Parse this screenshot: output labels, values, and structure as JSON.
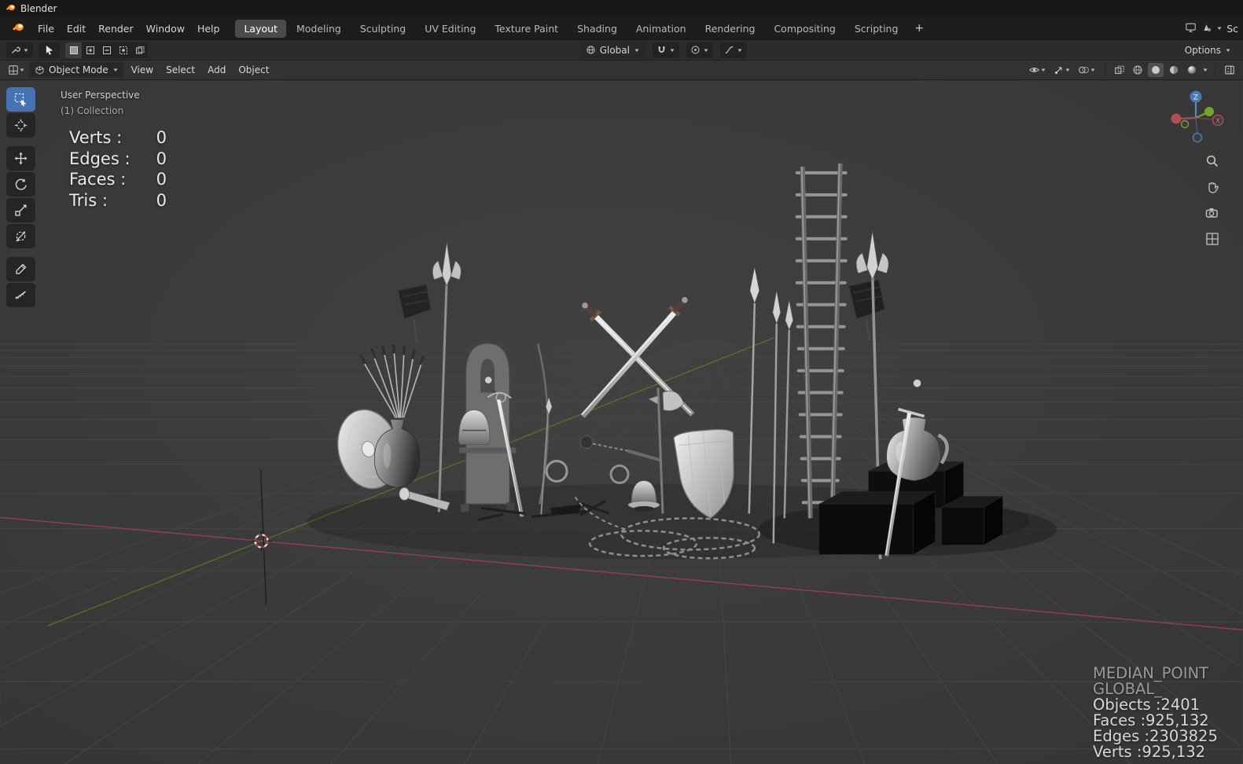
{
  "titlebar": {
    "app_name": "Blender"
  },
  "menubar": {
    "menus": [
      "File",
      "Edit",
      "Render",
      "Window",
      "Help"
    ],
    "workspaces": [
      "Layout",
      "Modeling",
      "Sculpting",
      "UV Editing",
      "Texture Paint",
      "Shading",
      "Animation",
      "Rendering",
      "Compositing",
      "Scripting"
    ],
    "active_workspace": "Layout",
    "add_workspace_label": "+",
    "scene_label": "Sc"
  },
  "tool_settings": {
    "orientation_value": "Global",
    "options_label": "Options"
  },
  "viewport_header": {
    "mode_value": "Object Mode",
    "menus": [
      "View",
      "Select",
      "Add",
      "Object"
    ]
  },
  "viewport": {
    "view_label": "User Perspective",
    "collection_label": "(1) Collection",
    "stats": {
      "rows": [
        {
          "label": "Verts :",
          "value": "0"
        },
        {
          "label": "Edges :",
          "value": "0"
        },
        {
          "label": "Faces :",
          "value": "0"
        },
        {
          "label": "Tris :",
          "value": "0"
        }
      ]
    },
    "gizmo_axis_labels": {
      "x": "X",
      "z": "Z"
    },
    "info_overlay": {
      "pivot": "MEDIAN_POINT",
      "orientation": "GLOBAL_",
      "objects": "Objects :2401",
      "faces": "Faces :925,132",
      "edges": "Edges :2303825",
      "verts": "Verts :925,132"
    }
  },
  "colors": {
    "accent_blue": "#4772b3",
    "axis_x_red": "#9e4150",
    "axis_y_green": "#66821f",
    "axis_z_blue": "#4a7ab5",
    "viewport_bg": "#3a3a3a"
  }
}
